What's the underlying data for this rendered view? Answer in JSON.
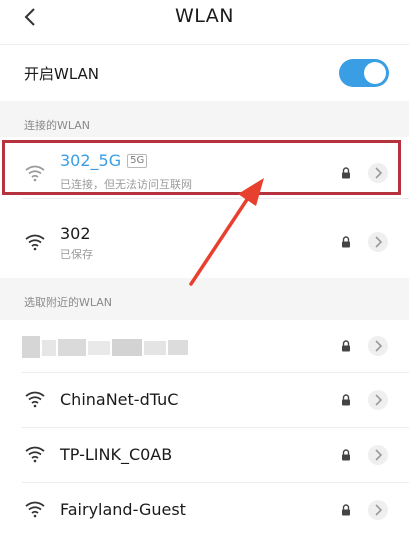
{
  "header": {
    "title": "WLAN"
  },
  "toggle": {
    "label": "开启WLAN",
    "on": true,
    "color": "#3a9ee4"
  },
  "sections": {
    "connected": "连接的WLAN",
    "nearby": "选取附近的WLAN"
  },
  "connected_network": {
    "ssid": "302_5G",
    "band": "5G",
    "status": "已连接，但无法访问互联网"
  },
  "saved_network": {
    "ssid": "302",
    "status": "已保存"
  },
  "nearby_networks": [
    {
      "ssid": "ChinaNet-dTuC"
    },
    {
      "ssid": "TP-LINK_C0AB"
    },
    {
      "ssid": "Fairyland-Guest"
    }
  ],
  "colors": {
    "highlight": "#b6323d",
    "arrow": "#e8402e",
    "accent": "#3a9ee4"
  }
}
